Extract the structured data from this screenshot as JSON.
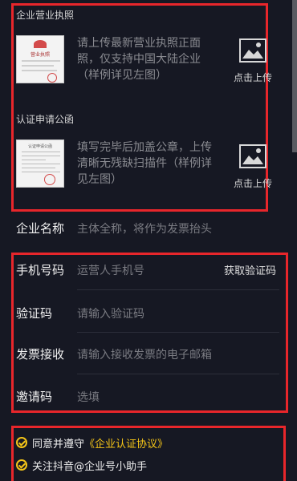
{
  "license_section": {
    "title": "企业营业执照",
    "thumbnail_title": "营业执照",
    "description": "请上传最新营业执照正面照，仅支持中国大陆企业（样例详见左图）",
    "upload_label": "点击上传"
  },
  "letter_section": {
    "title": "认证申请公函",
    "thumbnail_title": "认证申请公函",
    "description": "填写完毕后加盖公章，上传清晰无残缺扫描件（样例详见左图）",
    "upload_label": "点击上传"
  },
  "company_name": {
    "label": "企业名称",
    "placeholder": "主体全称，将作为发票抬头"
  },
  "phone": {
    "label": "手机号码",
    "placeholder": "运营人手机号",
    "action": "获取验证码"
  },
  "verify_code": {
    "label": "验证码",
    "placeholder": "请输入验证码"
  },
  "invoice": {
    "label": "发票接收",
    "placeholder": "请输入接收发票的电子邮箱"
  },
  "invite": {
    "label": "邀请码",
    "placeholder": "选填"
  },
  "agreements": {
    "agree_prefix": "同意并遵守",
    "agree_link": "《企业认证协议》",
    "follow": "关注抖音@企业号小助手"
  },
  "colors": {
    "background": "#161823",
    "highlight": "#e8262b",
    "accent": "#f5c518"
  }
}
